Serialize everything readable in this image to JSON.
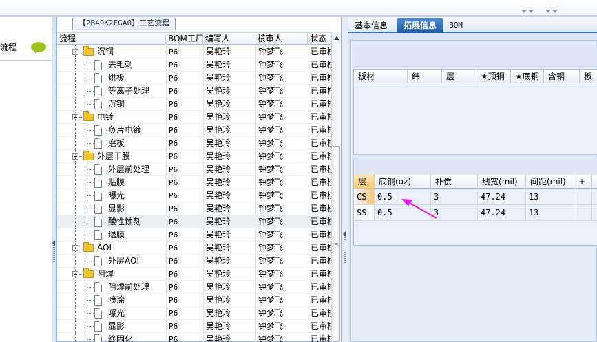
{
  "colors": {
    "accent": "#2f6fb5",
    "annotation_arrow": "#e81ae0",
    "folder": "#f1c232"
  },
  "left_panel": {
    "label": "流程",
    "icon": "chat-bubble-icon"
  },
  "tree_panel": {
    "tab_title": "【2B49K2EGA0】工艺流程",
    "columns": [
      "流程",
      "BOM工厂",
      "编写人",
      "核审人",
      "状态"
    ],
    "rows": [
      {
        "name": "沉铜",
        "type": "folder",
        "level": 1,
        "bom": "P6",
        "author": "吴艳玲",
        "reviewer": "钟梦飞",
        "status": "已审核"
      },
      {
        "name": "去毛刺",
        "type": "doc",
        "level": 2,
        "bom": "P6",
        "author": "吴艳玲",
        "reviewer": "钟梦飞",
        "status": "已审核"
      },
      {
        "name": "烘板",
        "type": "doc",
        "level": 2,
        "bom": "P6",
        "author": "吴艳玲",
        "reviewer": "钟梦飞",
        "status": "已审核"
      },
      {
        "name": "等离子处理",
        "type": "doc",
        "level": 2,
        "bom": "P6",
        "author": "吴艳玲",
        "reviewer": "钟梦飞",
        "status": "已审核"
      },
      {
        "name": "沉铜",
        "type": "doc",
        "level": 2,
        "bom": "P6",
        "author": "吴艳玲",
        "reviewer": "钟梦飞",
        "status": "已审核"
      },
      {
        "name": "电镀",
        "type": "folder",
        "level": 1,
        "bom": "P6",
        "author": "吴艳玲",
        "reviewer": "钟梦飞",
        "status": "已审核"
      },
      {
        "name": "负片电镀",
        "type": "doc",
        "level": 2,
        "bom": "P6",
        "author": "吴艳玲",
        "reviewer": "钟梦飞",
        "status": "已审核"
      },
      {
        "name": "磨板",
        "type": "doc",
        "level": 2,
        "bom": "P6",
        "author": "吴艳玲",
        "reviewer": "钟梦飞",
        "status": "已审核"
      },
      {
        "name": "外层干膜",
        "type": "folder",
        "level": 1,
        "bom": "P6",
        "author": "吴艳玲",
        "reviewer": "钟梦飞",
        "status": "已审核"
      },
      {
        "name": "外层前处理",
        "type": "doc",
        "level": 2,
        "bom": "P6",
        "author": "吴艳玲",
        "reviewer": "钟梦飞",
        "status": "已审核"
      },
      {
        "name": "贴膜",
        "type": "doc",
        "level": 2,
        "bom": "P6",
        "author": "吴艳玲",
        "reviewer": "钟梦飞",
        "status": "已审核"
      },
      {
        "name": "曝光",
        "type": "doc",
        "level": 2,
        "bom": "P6",
        "author": "吴艳玲",
        "reviewer": "钟梦飞",
        "status": "已审核"
      },
      {
        "name": "显影",
        "type": "doc",
        "level": 2,
        "bom": "P6",
        "author": "吴艳玲",
        "reviewer": "钟梦飞",
        "status": "已审核"
      },
      {
        "name": "酸性蚀刻",
        "type": "doc",
        "level": 2,
        "bom": "P6",
        "author": "吴艳玲",
        "reviewer": "钟梦飞",
        "status": "已审核",
        "selected": true
      },
      {
        "name": "退膜",
        "type": "doc",
        "level": 2,
        "bom": "P6",
        "author": "吴艳玲",
        "reviewer": "钟梦飞",
        "status": "已审核"
      },
      {
        "name": "AOI",
        "type": "folder",
        "level": 1,
        "bom": "P6",
        "author": "吴艳玲",
        "reviewer": "钟梦飞",
        "status": "已审核"
      },
      {
        "name": "外层AOI",
        "type": "doc",
        "level": 2,
        "bom": "P6",
        "author": "吴艳玲",
        "reviewer": "钟梦飞",
        "status": "已审核"
      },
      {
        "name": "阻焊",
        "type": "folder",
        "level": 1,
        "bom": "P6",
        "author": "吴艳玲",
        "reviewer": "钟梦飞",
        "status": "已审核"
      },
      {
        "name": "阻焊前处理",
        "type": "doc",
        "level": 2,
        "bom": "P6",
        "author": "吴艳玲",
        "reviewer": "钟梦飞",
        "status": "已审核"
      },
      {
        "name": "喷涂",
        "type": "doc",
        "level": 2,
        "bom": "P6",
        "author": "吴艳玲",
        "reviewer": "钟梦飞",
        "status": "已审核"
      },
      {
        "name": "曝光",
        "type": "doc",
        "level": 2,
        "bom": "P6",
        "author": "吴艳玲",
        "reviewer": "钟梦飞",
        "status": "已审核"
      },
      {
        "name": "显影",
        "type": "doc",
        "level": 2,
        "bom": "P6",
        "author": "吴艳玲",
        "reviewer": "钟梦飞",
        "status": "已审核"
      },
      {
        "name": "终固化",
        "type": "doc",
        "level": 2,
        "bom": "P6",
        "author": "吴艳玲",
        "reviewer": "钟梦飞",
        "status": "已审核"
      }
    ]
  },
  "right_panel": {
    "tabs": [
      {
        "label": "基本信息",
        "active": false
      },
      {
        "label": "拓展信息",
        "active": true
      },
      {
        "label": "BOM",
        "active": false
      }
    ],
    "board_grid": {
      "columns": [
        "板材",
        "纬",
        "层",
        "★顶铜",
        "★底铜",
        "含铜",
        "板"
      ]
    },
    "layer_grid": {
      "columns": [
        "层",
        "底铜(oz)",
        "补偿",
        "线宽(mil)",
        "间距(mil)",
        "+"
      ],
      "rows": [
        {
          "layer": "CS",
          "base_copper": "0.5",
          "compensation": "3",
          "line_width": "47.24",
          "spacing": "13"
        },
        {
          "layer": "SS",
          "base_copper": "0.5",
          "compensation": "3",
          "line_width": "47.24",
          "spacing": "13"
        }
      ]
    }
  }
}
